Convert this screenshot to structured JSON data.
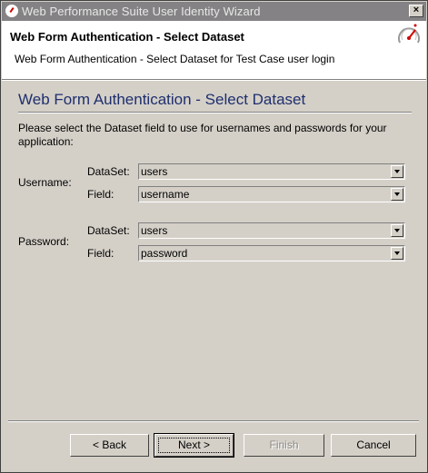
{
  "window": {
    "title": "Web Performance Suite User Identity Wizard",
    "close_label": "×"
  },
  "header": {
    "title": "Web Form Authentication - Select Dataset",
    "subtitle": "Web Form Authentication - Select Dataset for Test Case user login"
  },
  "content": {
    "title": "Web Form Authentication - Select Dataset",
    "instructions": "Please select the Dataset field to use for usernames and passwords for your application:",
    "username": {
      "label": "Username:",
      "dataset_label": "DataSet:",
      "dataset_value": "users",
      "field_label": "Field:",
      "field_value": "username"
    },
    "password": {
      "label": "Password:",
      "dataset_label": "DataSet:",
      "dataset_value": "users",
      "field_label": "Field:",
      "field_value": "password"
    }
  },
  "buttons": {
    "back": "< Back",
    "next": "Next >",
    "finish": "Finish",
    "cancel": "Cancel"
  },
  "colors": {
    "title_text": "#1f2f6e",
    "titlebar_inactive": "#848284",
    "dialog_bg": "#d4d0c8"
  }
}
